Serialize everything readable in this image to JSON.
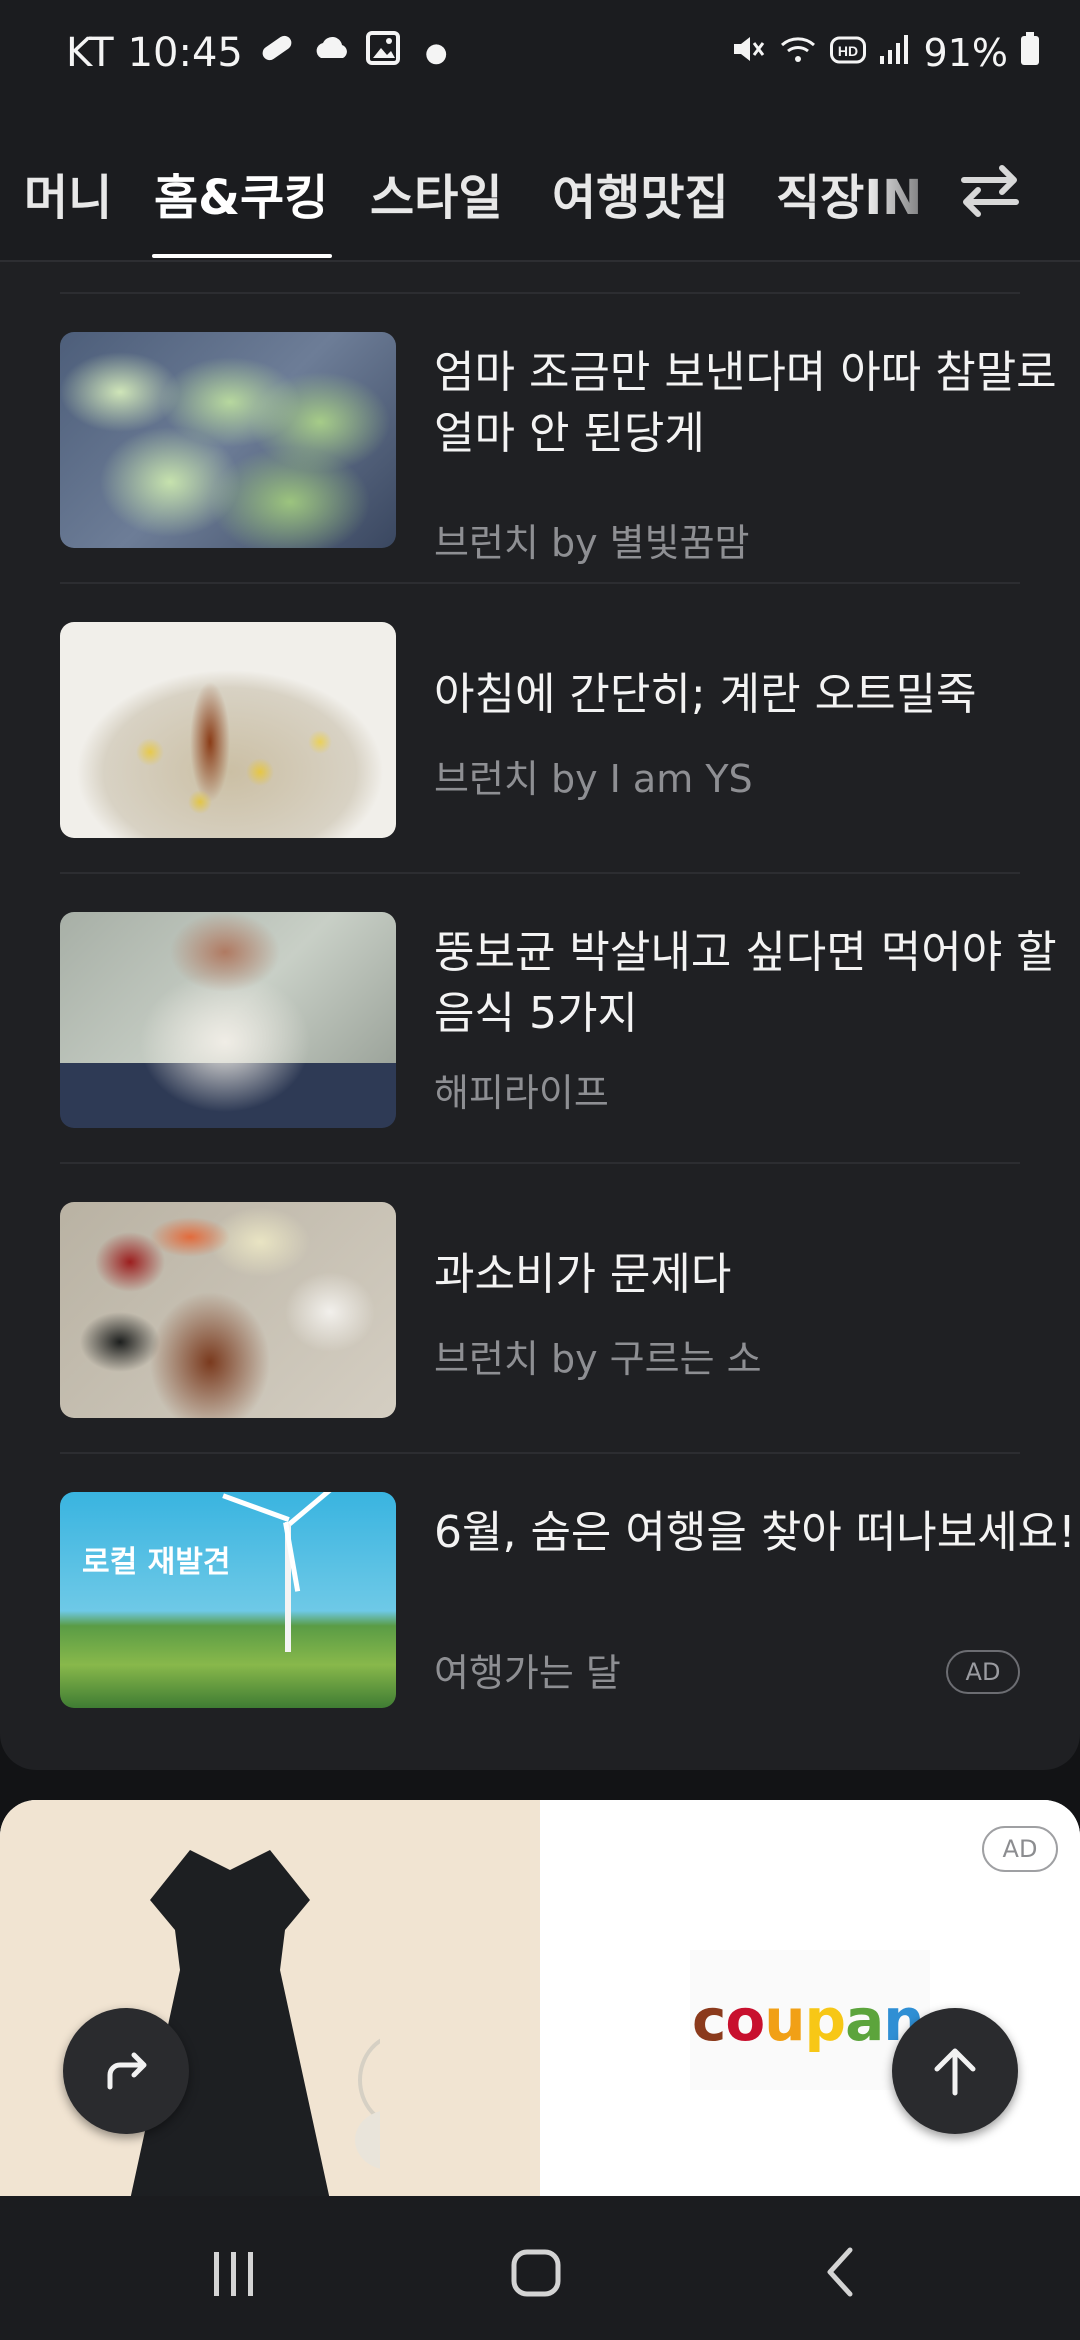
{
  "status_bar": {
    "carrier": "KT",
    "time": "10:45",
    "left_icons": [
      "pill-icon",
      "cloud-icon",
      "image-icon",
      "dot-icon"
    ],
    "right_icons": [
      "mute-icon",
      "wifi-icon",
      "hd-icon",
      "signal-icon"
    ],
    "battery": "91%"
  },
  "tabs": {
    "items": [
      {
        "label": "머니"
      },
      {
        "label": "홈&쿠킹"
      },
      {
        "label": "스타일"
      },
      {
        "label": "여행맛집"
      },
      {
        "label": "직장IN"
      }
    ],
    "active": "홈&쿠킹",
    "swap_icon": "swap-arrows-icon"
  },
  "feed": {
    "items": [
      {
        "title": "엄마 조금만 보낸다며 아따 참말로 얼마 안 된당게",
        "source": "브런치 by 별빛꿈맘",
        "image": "napa-cabbage-photo"
      },
      {
        "title": "아침에 간단히; 계란 오트밀죽",
        "source": "브런치 by I am YS",
        "image": "oatmeal-porridge-photo"
      },
      {
        "title": "뚱보균 박살내고 싶다면 먹어야 할 음식 5가지",
        "source": "해피라이프",
        "image": "overweight-man-photo"
      },
      {
        "title": "과소비가 문제다",
        "source": "브런치 by 구르는 소",
        "image": "food-spread-photo"
      },
      {
        "title": "6월, 숨은 여행을 찾아 떠나보세요!",
        "source": "여행가는 달",
        "image": "wind-turbine-photo",
        "badge": "AD",
        "image_text": "로컬 재발견"
      }
    ]
  },
  "ad_banner": {
    "badge": "AD",
    "brand": "coupang",
    "brand_letters": [
      "c",
      "o",
      "u",
      "p",
      "a",
      "n"
    ]
  },
  "fabs": {
    "share_icon": "share-icon",
    "scroll_top_icon": "arrow-up-icon"
  },
  "nav": {
    "recents_icon": "recents-icon",
    "home_icon": "home-icon",
    "back_icon": "back-icon"
  }
}
